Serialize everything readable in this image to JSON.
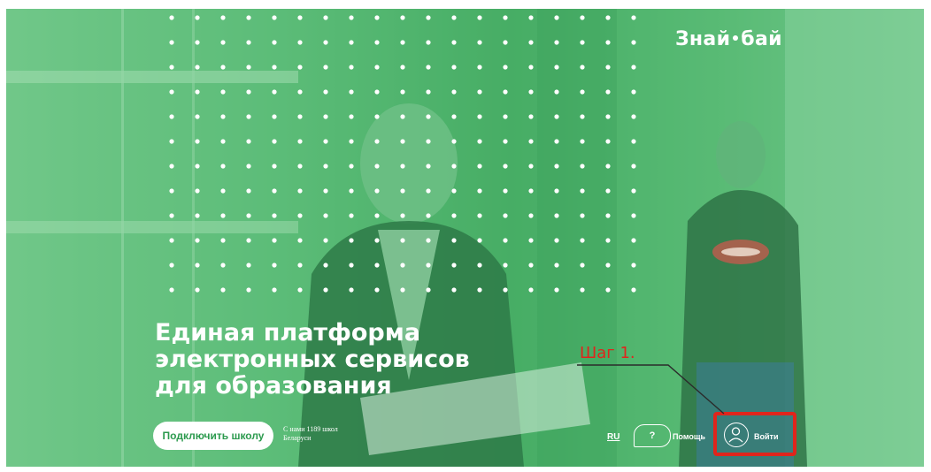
{
  "header": {
    "logo_left": "Знай",
    "logo_right": "бай"
  },
  "hero": {
    "headline_line1": "Единая платформа",
    "headline_line2": "электронных сервисов",
    "headline_line3": "для образования"
  },
  "actions": {
    "connect_label": "Подключить школу",
    "stats_line1": "С нами 1189 школ",
    "stats_line2": "Беларуси"
  },
  "nav": {
    "lang": "RU",
    "help_icon": "?",
    "help_label": "Помощь",
    "login_label": "Войти"
  },
  "annotation": {
    "step_label": "Шаг 1.",
    "color": "#e0251c"
  },
  "colors": {
    "accent": "#2c9a4e",
    "overlay": "#4fb36c",
    "highlight": "#e0251c"
  },
  "icons": {
    "help": "question-bubble-icon",
    "login": "user-circle-icon"
  }
}
